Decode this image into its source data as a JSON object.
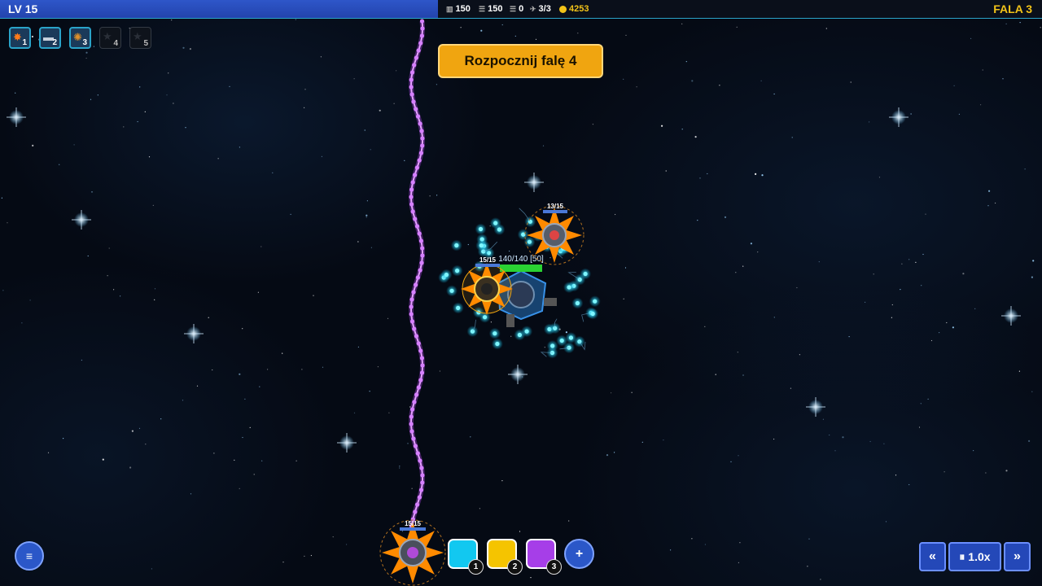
{
  "topbar": {
    "level": "LV 15",
    "xp_fraction": 0.42,
    "resources": [
      {
        "icon": "ammo-icon",
        "value": "150"
      },
      {
        "icon": "ammo-icon",
        "value": "150"
      },
      {
        "icon": "ammo-icon",
        "value": "0"
      },
      {
        "icon": "drone-icon",
        "value": "3/3"
      },
      {
        "icon": "coin-icon",
        "value": "4253"
      }
    ],
    "wave": "FALA 3"
  },
  "slots": [
    {
      "num": "1",
      "unlocked": true,
      "icon": "explosion-icon"
    },
    {
      "num": "2",
      "unlocked": true,
      "icon": "cannon-icon"
    },
    {
      "num": "3",
      "unlocked": true,
      "icon": "mine-icon"
    },
    {
      "num": "4",
      "unlocked": false,
      "icon": "star-icon"
    },
    {
      "num": "5",
      "unlocked": false,
      "icon": "star-icon"
    }
  ],
  "start_wave_label": "Rozpocznij falę 4",
  "base": {
    "hp_label": "140/140 [50]"
  },
  "turrets": [
    {
      "hp_label": "13/15"
    },
    {
      "hp_label": "15/15"
    },
    {
      "hp_label": "15/15"
    }
  ],
  "bottom": {
    "menu_icon": "≡",
    "colors": [
      {
        "num": "1",
        "color": "#12c8f0"
      },
      {
        "num": "2",
        "color": "#f5c400"
      },
      {
        "num": "3",
        "color": "#a63ee8"
      }
    ],
    "add_label": "+",
    "speed": {
      "slower": "«",
      "pause_label": "⏸ 1.0x",
      "faster": "»"
    }
  },
  "colors": {
    "accent": "#2aa3c9",
    "gold": "#f2c318",
    "laser": "#c44dff"
  }
}
